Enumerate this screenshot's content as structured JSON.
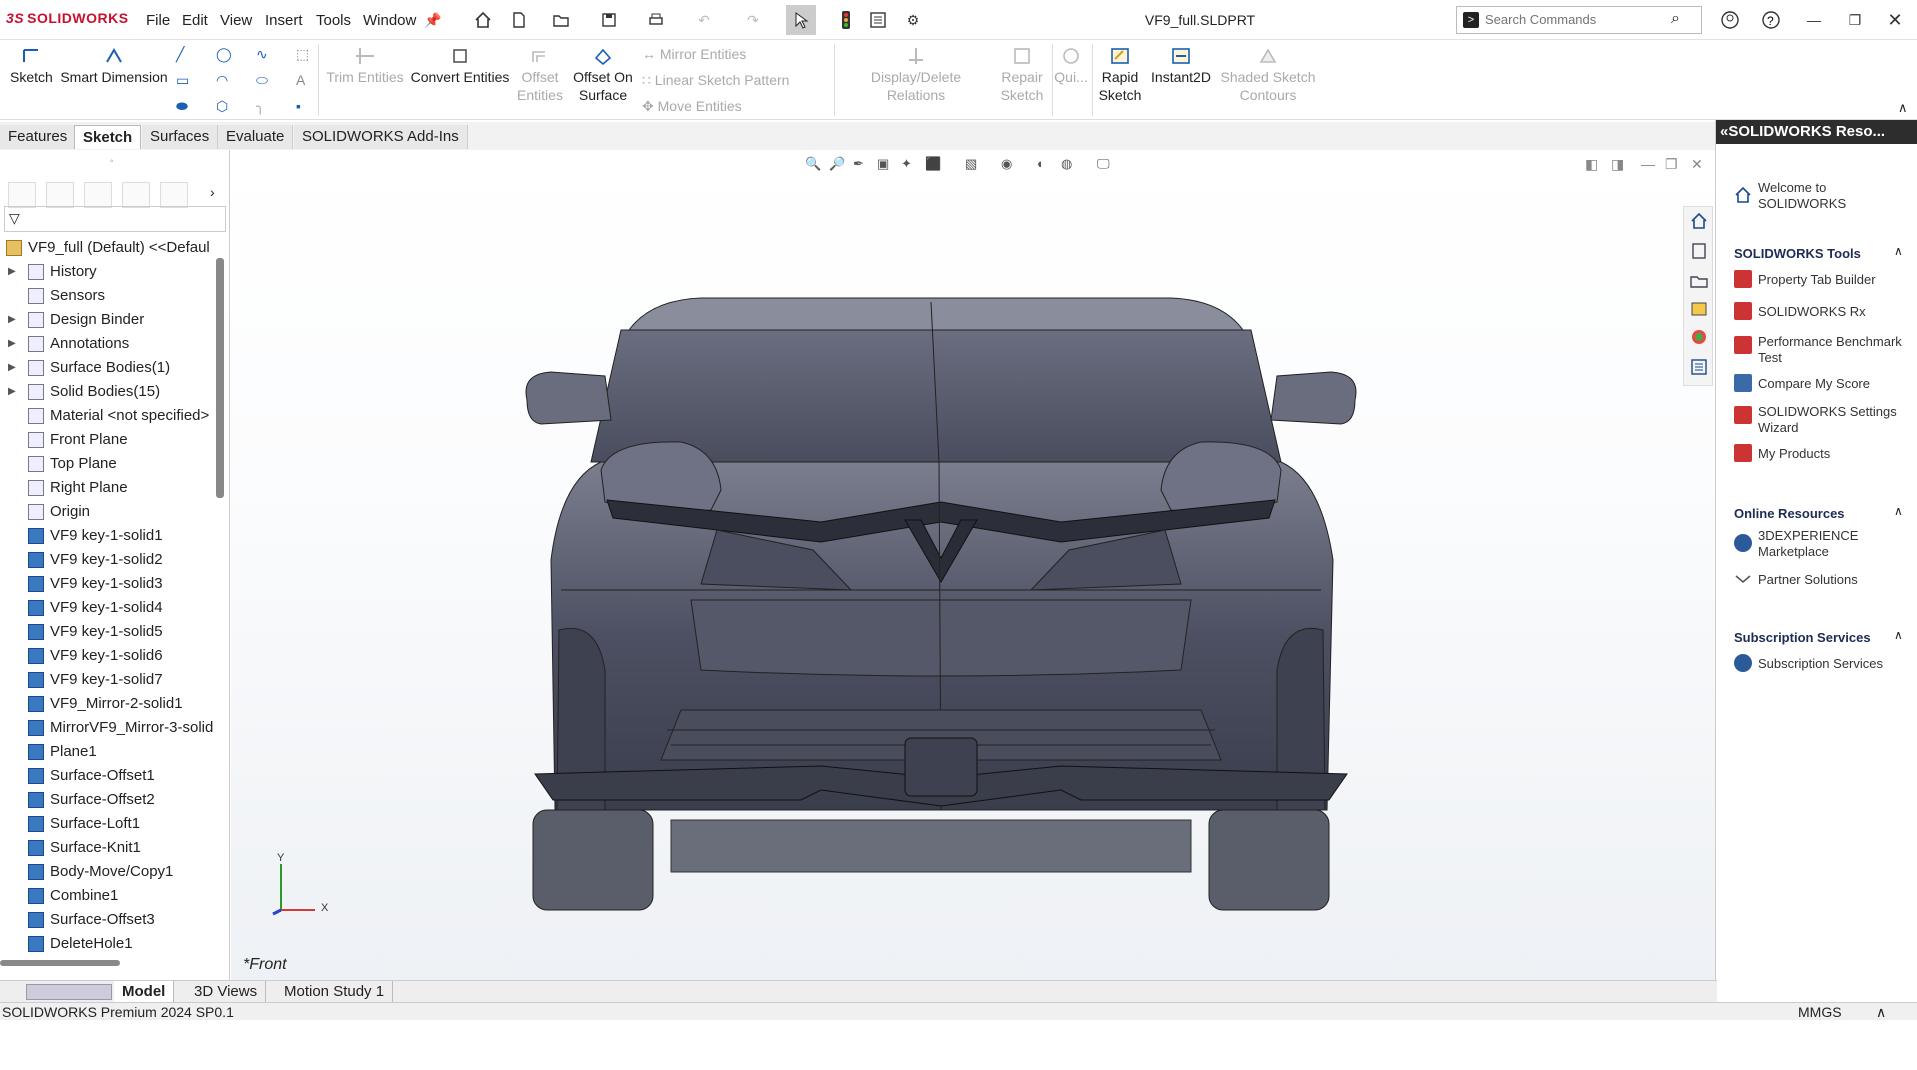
{
  "app": {
    "brand": "SOLIDWORKS",
    "document_title": "VF9_full.SLDPRT"
  },
  "menu": [
    "File",
    "Edit",
    "View",
    "Insert",
    "Tools",
    "Window"
  ],
  "search": {
    "placeholder": "Search Commands"
  },
  "commands": {
    "sketch": "Sketch",
    "smart_dimension": "Smart Dimension",
    "trim_entities": "Trim Entities",
    "convert_entities": "Convert Entities",
    "offset_entities": "Offset Entities",
    "offset_on_surface": "Offset On Surface",
    "mirror_entities": "Mirror Entities",
    "linear_sketch_pattern": "Linear Sketch Pattern",
    "move_entities": "Move Entities",
    "display_delete_relations": "Display/Delete Relations",
    "repair_sketch": "Repair Sketch",
    "quick_snaps": "Qui...",
    "rapid_sketch": "Rapid Sketch",
    "instant2d": "Instant2D",
    "shaded_sketch_contours": "Shaded Sketch Contours"
  },
  "tabs": [
    "Features",
    "Sketch",
    "Surfaces",
    "Evaluate",
    "SOLIDWORKS Add-Ins"
  ],
  "active_tab": "Sketch",
  "tree": {
    "root": "VF9_full (Default) <<Defaul",
    "items": [
      {
        "label": "History",
        "expandable": true
      },
      {
        "label": "Sensors",
        "expandable": false
      },
      {
        "label": "Design Binder",
        "expandable": true
      },
      {
        "label": "Annotations",
        "expandable": true
      },
      {
        "label": "Surface Bodies(1)",
        "expandable": true
      },
      {
        "label": "Solid Bodies(15)",
        "expandable": true
      },
      {
        "label": "Material <not specified>",
        "expandable": false
      },
      {
        "label": "Front Plane",
        "expandable": false
      },
      {
        "label": "Top Plane",
        "expandable": false
      },
      {
        "label": "Right Plane",
        "expandable": false
      },
      {
        "label": "Origin",
        "expandable": false
      },
      {
        "label": "VF9 key-1-solid1",
        "expandable": false
      },
      {
        "label": "VF9 key-1-solid2",
        "expandable": false
      },
      {
        "label": "VF9 key-1-solid3",
        "expandable": false
      },
      {
        "label": "VF9 key-1-solid4",
        "expandable": false
      },
      {
        "label": "VF9 key-1-solid5",
        "expandable": false
      },
      {
        "label": "VF9 key-1-solid6",
        "expandable": false
      },
      {
        "label": "VF9 key-1-solid7",
        "expandable": false
      },
      {
        "label": "VF9_Mirror-2-solid1",
        "expandable": false
      },
      {
        "label": "MirrorVF9_Mirror-3-solid",
        "expandable": false
      },
      {
        "label": "Plane1",
        "expandable": false
      },
      {
        "label": "Surface-Offset1",
        "expandable": false
      },
      {
        "label": "Surface-Offset2",
        "expandable": false
      },
      {
        "label": "Surface-Loft1",
        "expandable": false
      },
      {
        "label": "Surface-Knit1",
        "expandable": false
      },
      {
        "label": "Body-Move/Copy1",
        "expandable": false
      },
      {
        "label": "Combine1",
        "expandable": false
      },
      {
        "label": "Surface-Offset3",
        "expandable": false
      },
      {
        "label": "DeleteHole1",
        "expandable": false
      }
    ]
  },
  "viewport": {
    "view_label": "*Front",
    "triad_y": "Y",
    "triad_x": "X"
  },
  "taskpane": {
    "title": "SOLIDWORKS Reso...",
    "welcome": "Welcome to SOLIDWORKS",
    "tools_header": "SOLIDWORKS Tools",
    "tools": [
      "Property Tab Builder",
      "SOLIDWORKS Rx",
      "Performance Benchmark Test",
      "Compare My Score",
      "SOLIDWORKS Settings Wizard",
      "My Products"
    ],
    "online_header": "Online Resources",
    "online": [
      "3DEXPERIENCE Marketplace",
      "Partner Solutions"
    ],
    "subscription_header": "Subscription Services",
    "subscription": [
      "Subscription Services"
    ]
  },
  "bottom_tabs": [
    "Model",
    "3D Views",
    "Motion Study 1"
  ],
  "status": {
    "product": "SOLIDWORKS Premium 2024 SP0.1",
    "units": "MMGS"
  }
}
